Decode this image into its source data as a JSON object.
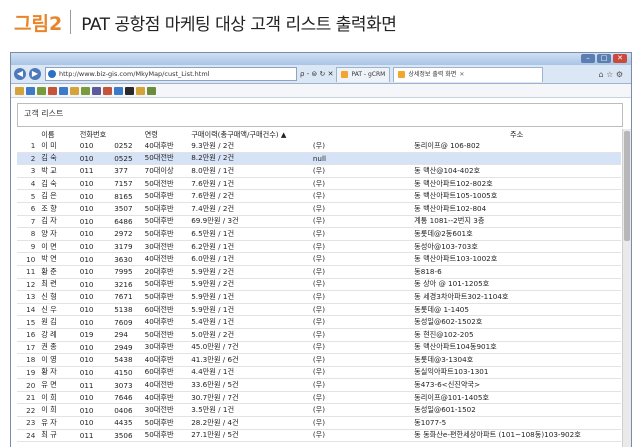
{
  "figure": {
    "label": "그림2",
    "title": "PAT 공항점 마케팅 대상 고객 리스트 출력화면"
  },
  "browser": {
    "address": "http://www.biz-gis.com/MkyMap/cust_List.html",
    "addr_tools": "ρ - ⊜ ↻ ✕",
    "tabs": [
      {
        "label": "PAT - gCRM",
        "active": false
      },
      {
        "label": "상세정보 출력 화면",
        "active": true
      }
    ],
    "right_icons": "⌂ ☆ ⚙"
  },
  "toolbar_colors": [
    "#d4a43a",
    "#3d7bc8",
    "#7a9b3c",
    "#c4543a",
    "#3d7bc8",
    "#d4a43a",
    "#7a9b3c",
    "#5a5a9c",
    "#c4543a",
    "#3d7bc8",
    "#2a2a2a",
    "#d4a43a",
    "#6a8c3c"
  ],
  "panel": {
    "title": "고객 리스트"
  },
  "table": {
    "columns": [
      "",
      "이름",
      "전화번호",
      "",
      "연령",
      "구매이력(총구매액/구매건수) ▲",
      "",
      "주소"
    ],
    "rows": [
      [
        "1",
        "이 미",
        "010",
        "0252",
        "40대후반",
        "9.3만원 / 2건",
        "(우)",
        "동리이프@ 106-802"
      ],
      [
        "2",
        "김 숙",
        "010",
        "0525",
        "50대전반",
        "8.2만원 / 2건",
        "null",
        ""
      ],
      [
        "3",
        "박 교",
        "011",
        "377",
        "70대이상",
        "8.0만원 / 1건",
        "(우)",
        "동 맥산@104-402호"
      ],
      [
        "4",
        "김 숙",
        "010",
        "7157",
        "50대전반",
        "7.6만원 / 1건",
        "(우)",
        "동 맥산아파트102-802호"
      ],
      [
        "5",
        "김 은",
        "010",
        "8165",
        "50대후반",
        "7.6만원 / 2건",
        "(우)",
        "동 백산아파트105-1005호"
      ],
      [
        "6",
        "조 향",
        "010",
        "3507",
        "50대후반",
        "7.4만원 / 2건",
        "(우)",
        "동 백산아파트102-804"
      ],
      [
        "7",
        "김 자",
        "010",
        "6486",
        "50대후반",
        "69.9만원 / 3건",
        "(우)",
        "계통 1081--2번지 3층"
      ],
      [
        "8",
        "양 자",
        "010",
        "2972",
        "50대후반",
        "6.5만원 / 1건",
        "(우)",
        "동롯데@2동601호"
      ],
      [
        "9",
        "이 면",
        "010",
        "3179",
        "30대전반",
        "6.2만원 / 1건",
        "(우)",
        "동성아@103-703호"
      ],
      [
        "10",
        "박 연",
        "010",
        "3630",
        "40대전반",
        "6.0만원 / 1건",
        "(우)",
        "동 맥산아파트103-1002호"
      ],
      [
        "11",
        "황 준",
        "010",
        "7995",
        "20대후반",
        "5.9만원 / 2건",
        "(우)",
        "동818-6"
      ],
      [
        "12",
        "최 련",
        "010",
        "3216",
        "50대후반",
        "5.9만원 / 2건",
        "(우)",
        "동 상아 @ 101-1205호"
      ],
      [
        "13",
        "신 형",
        "010",
        "7671",
        "50대후반",
        "5.9만원 / 1건",
        "(우)",
        "동 세경3차아파트302-1104호"
      ],
      [
        "14",
        "신 우",
        "010",
        "5138",
        "60대전반",
        "5.9만원 / 1건",
        "(우)",
        "동롯데@ 1-1405"
      ],
      [
        "15",
        "원 김",
        "010",
        "7609",
        "40대후반",
        "5.4만원 / 1건",
        "(우)",
        "동성일@602-1502호"
      ],
      [
        "16",
        "강 례",
        "019",
        "294",
        "50대전반",
        "5.0만원 / 2건",
        "(우)",
        "동 현진@102-205"
      ],
      [
        "17",
        "권 종",
        "010",
        "2949",
        "30대후반",
        "45.0만원 / 7건",
        "(우)",
        "동 맥산아파트104동901호"
      ],
      [
        "18",
        "이 영",
        "010",
        "5438",
        "40대후반",
        "41.3만원 / 6건",
        "(우)",
        "동롯데@3-1304호"
      ],
      [
        "19",
        "황 자",
        "010",
        "4150",
        "60대후반",
        "4.4만원 / 1건",
        "(우)",
        "동실익아파트103-1301"
      ],
      [
        "20",
        "유 면",
        "011",
        "3073",
        "40대전반",
        "33.6만원 / 5건",
        "(우)",
        "동473-6<신진약국>"
      ],
      [
        "21",
        "이 희",
        "010",
        "7646",
        "40대후반",
        "30.7만원 / 7건",
        "(우)",
        "동리이프@101-1405호"
      ],
      [
        "22",
        "이 희",
        "010",
        "0406",
        "30대전반",
        "3.5만원 / 1건",
        "(우)",
        "동성일@601-1502"
      ],
      [
        "23",
        "유 자",
        "010",
        "4435",
        "50대후반",
        "28.2만원 / 4건",
        "(우)",
        "동1077-5"
      ],
      [
        "24",
        "최 규",
        "011",
        "3506",
        "50대후반",
        "27.1만원 / 5건",
        "(우)",
        "동 동화산e-편한세상아파트 (101~108동)103-902호"
      ]
    ]
  }
}
